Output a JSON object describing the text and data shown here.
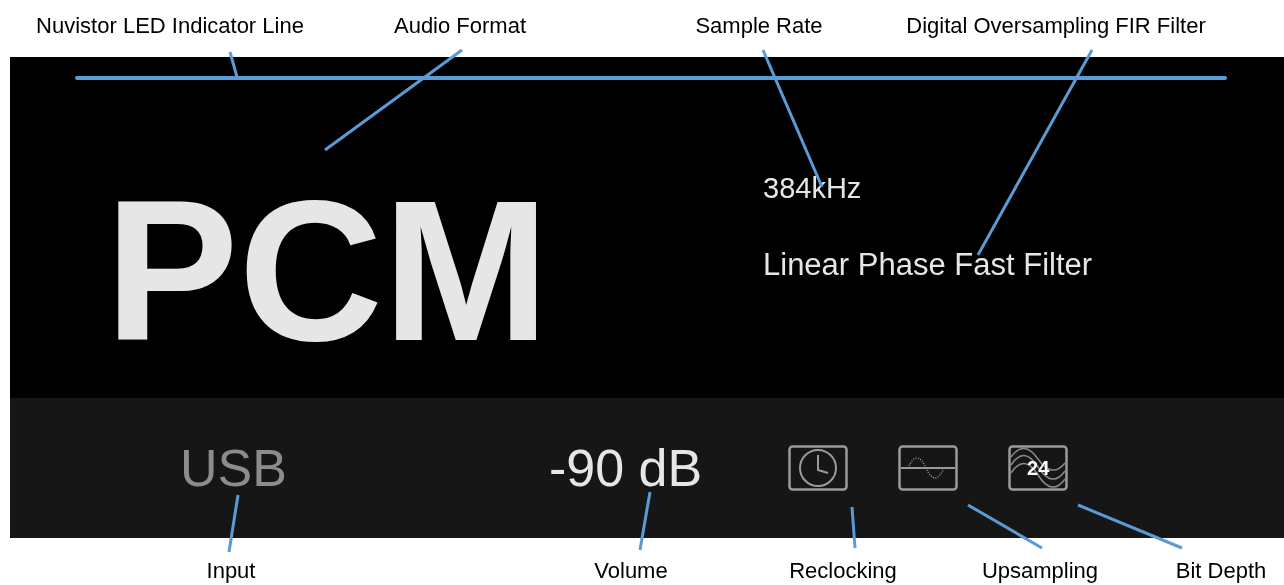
{
  "annotations_top": [
    {
      "label": "Nuvistor LED Indicator Line"
    },
    {
      "label": "Audio Format"
    },
    {
      "label": "Sample Rate"
    },
    {
      "label": "Digital Oversampling FIR Filter"
    }
  ],
  "display": {
    "led_line": true,
    "format": "PCM",
    "sample_rate": "384kHz",
    "filter": "Linear Phase Fast Filter"
  },
  "status_bar": {
    "input": "USB",
    "volume": "-90 dB",
    "icons": [
      {
        "kind": "clock"
      },
      {
        "kind": "wave"
      },
      {
        "kind": "bitdepth",
        "text": "24"
      }
    ]
  },
  "annotations_bottom": [
    {
      "label": "Input"
    },
    {
      "label": "Volume"
    },
    {
      "label": "Reclocking"
    },
    {
      "label": "Upsampling"
    },
    {
      "label": "Bit Depth"
    }
  ]
}
